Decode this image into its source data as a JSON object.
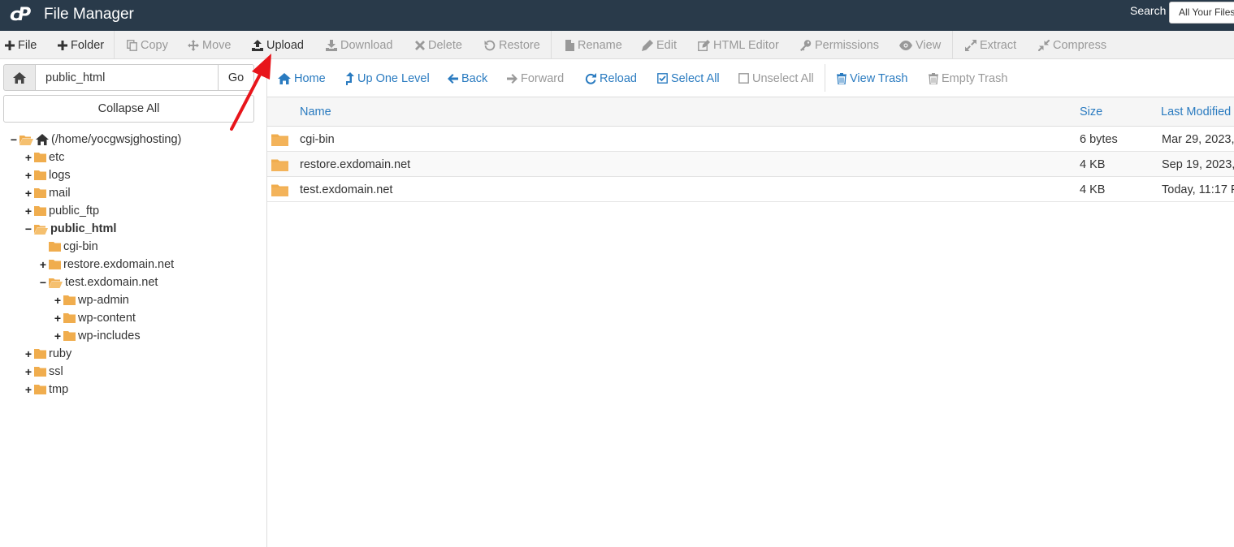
{
  "header": {
    "logo_text": "cP",
    "title": "File Manager",
    "search_label": "Search",
    "search_scope": "All Your Files"
  },
  "toolbar": [
    {
      "label": "File",
      "icon": "plus-icon",
      "enabled": true
    },
    {
      "label": "Folder",
      "icon": "plus-icon",
      "enabled": true
    },
    {
      "label": "Copy",
      "icon": "copy-icon",
      "enabled": false
    },
    {
      "label": "Move",
      "icon": "move-icon",
      "enabled": false
    },
    {
      "label": "Upload",
      "icon": "upload-icon",
      "enabled": true
    },
    {
      "label": "Download",
      "icon": "download-icon",
      "enabled": false
    },
    {
      "label": "Delete",
      "icon": "delete-icon",
      "enabled": false
    },
    {
      "label": "Restore",
      "icon": "restore-icon",
      "enabled": false
    },
    {
      "label": "Rename",
      "icon": "rename-icon",
      "enabled": false
    },
    {
      "label": "Edit",
      "icon": "pencil-icon",
      "enabled": false
    },
    {
      "label": "HTML Editor",
      "icon": "html-editor-icon",
      "enabled": false
    },
    {
      "label": "Permissions",
      "icon": "key-icon",
      "enabled": false
    },
    {
      "label": "View",
      "icon": "eye-icon",
      "enabled": false
    },
    {
      "label": "Extract",
      "icon": "expand-icon",
      "enabled": false
    },
    {
      "label": "Compress",
      "icon": "compress-icon",
      "enabled": false
    }
  ],
  "sidebar": {
    "path_value": "public_html",
    "go_label": "Go",
    "collapse_label": "Collapse All",
    "tree": [
      {
        "label": "(/home/yocgwsjghosting)",
        "toggle": "−",
        "depth": 0,
        "open": true,
        "home": true,
        "bold": false
      },
      {
        "label": "etc",
        "toggle": "+",
        "depth": 1,
        "open": false,
        "bold": false
      },
      {
        "label": "logs",
        "toggle": "+",
        "depth": 1,
        "open": false,
        "bold": false
      },
      {
        "label": "mail",
        "toggle": "+",
        "depth": 1,
        "open": false,
        "bold": false
      },
      {
        "label": "public_ftp",
        "toggle": "+",
        "depth": 1,
        "open": false,
        "bold": false
      },
      {
        "label": "public_html",
        "toggle": "−",
        "depth": 1,
        "open": true,
        "bold": true
      },
      {
        "label": "cgi-bin",
        "toggle": "",
        "depth": 2,
        "open": false,
        "bold": false
      },
      {
        "label": "restore.exdomain.net",
        "toggle": "+",
        "depth": 2,
        "open": false,
        "bold": false
      },
      {
        "label": "test.exdomain.net",
        "toggle": "−",
        "depth": 2,
        "open": true,
        "bold": false
      },
      {
        "label": "wp-admin",
        "toggle": "+",
        "depth": 3,
        "open": false,
        "bold": false
      },
      {
        "label": "wp-content",
        "toggle": "+",
        "depth": 3,
        "open": false,
        "bold": false
      },
      {
        "label": "wp-includes",
        "toggle": "+",
        "depth": 3,
        "open": false,
        "bold": false
      },
      {
        "label": "ruby",
        "toggle": "+",
        "depth": 1,
        "open": false,
        "bold": false
      },
      {
        "label": "ssl",
        "toggle": "+",
        "depth": 1,
        "open": false,
        "bold": false
      },
      {
        "label": "tmp",
        "toggle": "+",
        "depth": 1,
        "open": false,
        "bold": false
      }
    ]
  },
  "navbar": [
    {
      "label": "Home",
      "icon": "home-icon",
      "enabled": true
    },
    {
      "label": "Up One Level",
      "icon": "level-up-icon",
      "enabled": true
    },
    {
      "label": "Back",
      "icon": "arrow-left-icon",
      "enabled": true
    },
    {
      "label": "Forward",
      "icon": "arrow-right-icon",
      "enabled": false
    },
    {
      "label": "Reload",
      "icon": "reload-icon",
      "enabled": true
    },
    {
      "label": "Select All",
      "icon": "checkbox-checked-icon",
      "enabled": true
    },
    {
      "label": "Unselect All",
      "icon": "checkbox-empty-icon",
      "enabled": false
    },
    {
      "label": "View Trash",
      "icon": "trash-icon",
      "enabled": true
    },
    {
      "label": "Empty Trash",
      "icon": "trash-icon",
      "enabled": false
    }
  ],
  "table": {
    "columns": {
      "name": "Name",
      "size": "Size",
      "modified": "Last Modified"
    },
    "rows": [
      {
        "name": "cgi-bin",
        "size": "6 bytes",
        "modified": "Mar 29, 2023,"
      },
      {
        "name": "restore.exdomain.net",
        "size": "4 KB",
        "modified": "Sep 19, 2023,"
      },
      {
        "name": "test.exdomain.net",
        "size": "4 KB",
        "modified": "Today, 11:17 P"
      }
    ]
  },
  "colors": {
    "header_bg": "#293a4a",
    "link_blue": "#2a7bc0",
    "folder_yellow": "#f0ad4e",
    "annotation_red": "#e8151b"
  }
}
